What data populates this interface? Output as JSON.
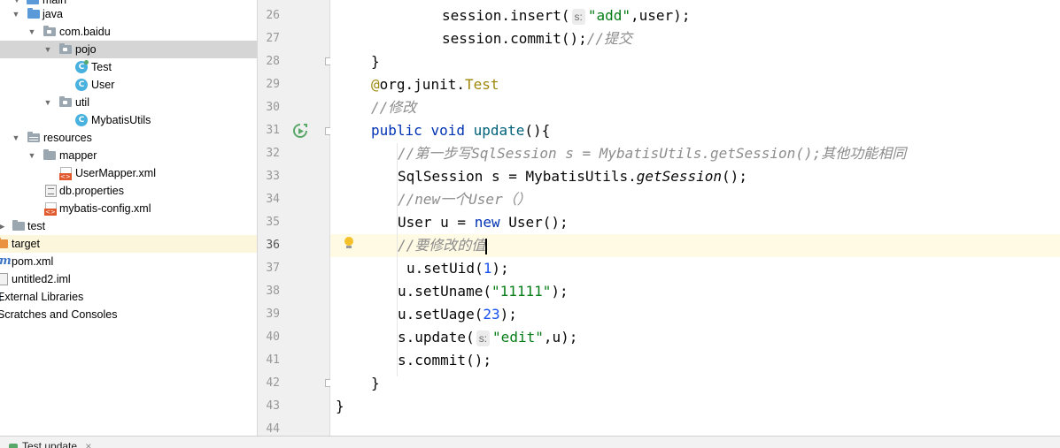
{
  "project_tree": {
    "items": [
      {
        "label": "main",
        "depth": 0,
        "icon": "folder-icon"
      },
      {
        "label": "java",
        "depth": 1,
        "icon": "source-folder-icon"
      },
      {
        "label": "com.baidu",
        "depth": 2,
        "icon": "package-icon"
      },
      {
        "label": "pojo",
        "depth": 3,
        "icon": "package-icon",
        "selected": true
      },
      {
        "label": "Test",
        "depth": 4,
        "icon": "test-class-icon"
      },
      {
        "label": "User",
        "depth": 4,
        "icon": "class-icon"
      },
      {
        "label": "util",
        "depth": 3,
        "icon": "package-icon"
      },
      {
        "label": "MybatisUtils",
        "depth": 4,
        "icon": "class-icon"
      },
      {
        "label": "resources",
        "depth": 1,
        "icon": "resources-folder-icon"
      },
      {
        "label": "mapper",
        "depth": 2,
        "icon": "folder-icon"
      },
      {
        "label": "UserMapper.xml",
        "depth": 3,
        "icon": "xml-file-icon"
      },
      {
        "label": "db.properties",
        "depth": 2,
        "icon": "properties-file-icon"
      },
      {
        "label": "mybatis-config.xml",
        "depth": 2,
        "icon": "xml-file-icon"
      },
      {
        "label": "test",
        "depth": 0,
        "icon": "folder-icon"
      },
      {
        "label": "target",
        "depth": -1,
        "icon": "excluded-folder-icon",
        "excluded": true
      },
      {
        "label": "pom.xml",
        "depth": -1,
        "icon": "maven-icon"
      },
      {
        "label": "untitled2.iml",
        "depth": -1,
        "icon": "iml-file-icon"
      },
      {
        "label": "External Libraries",
        "depth": -2,
        "icon": "libraries-icon"
      },
      {
        "label": "Scratches and Consoles",
        "depth": -2,
        "icon": "scratches-icon"
      }
    ]
  },
  "editor": {
    "line_numbers": [
      "26",
      "27",
      "28",
      "29",
      "30",
      "31",
      "32",
      "33",
      "34",
      "35",
      "36",
      "37",
      "38",
      "39",
      "40",
      "41",
      "42",
      "43",
      "44"
    ],
    "current_line": "36",
    "lines": {
      "l26": {
        "pre": "session.insert(",
        "hint": "s:",
        "str": "\"add\"",
        "post": ",user);"
      },
      "l27": {
        "code": "session.commit();",
        "comment": "//提交"
      },
      "l28": {
        "code": "}"
      },
      "l29": {
        "at": "@",
        "ann": "org.junit.",
        "annclass": "Test"
      },
      "l30": {
        "comment": "//修改"
      },
      "l31": {
        "kw1": "public",
        "kw2": "void",
        "name": "update",
        "rest": "(){"
      },
      "l32": {
        "comment": "//第一步写SqlSession s = MybatisUtils.getSession();其他功能相同"
      },
      "l33": {
        "pre": "SqlSession s = MybatisUtils.",
        "method": "getSession",
        "post": "();"
      },
      "l34": {
        "comment": "//new一个User（）"
      },
      "l35": {
        "pre": "User u = ",
        "kw": "new",
        "post": " User();"
      },
      "l36": {
        "comment": "//要修改的值"
      },
      "l37": {
        "pre": "u.setUid(",
        "num": "1",
        "post": ");"
      },
      "l38": {
        "pre": "u.setUname(",
        "str": "\"11111\"",
        "post": ");"
      },
      "l39": {
        "pre": "u.setUage(",
        "num": "23",
        "post": ");"
      },
      "l40": {
        "pre": "s.update(",
        "hint": "s:",
        "str": "\"edit\"",
        "post": ",u);"
      },
      "l41": {
        "code": "s.commit();"
      },
      "l42": {
        "code": "}"
      },
      "l43": {
        "code": "}"
      }
    }
  },
  "bottom_bar": {
    "tab_label": "Test.update"
  },
  "colors": {
    "keyword": "#0033b3",
    "string": "#067d17",
    "number": "#1750eb",
    "comment": "#8c8c8c",
    "annotation": "#9e880d",
    "selection": "#d5d5d5",
    "current_line": "#fffae3"
  }
}
